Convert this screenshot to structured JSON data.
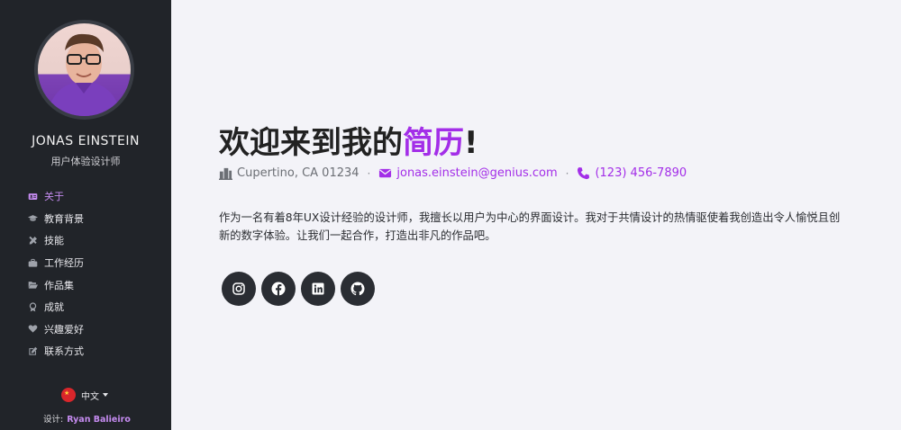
{
  "sidebar": {
    "name": "JONAS EINSTEIN",
    "role": "用户体验设计师",
    "nav": [
      {
        "label": "关于",
        "icon": "id-card-icon",
        "active": true
      },
      {
        "label": "教育背景",
        "icon": "graduation-cap-icon",
        "active": false
      },
      {
        "label": "技能",
        "icon": "tools-icon",
        "active": false
      },
      {
        "label": "工作经历",
        "icon": "briefcase-icon",
        "active": false
      },
      {
        "label": "作品集",
        "icon": "folder-open-icon",
        "active": false
      },
      {
        "label": "成就",
        "icon": "award-icon",
        "active": false
      },
      {
        "label": "兴趣爱好",
        "icon": "heart-icon",
        "active": false
      },
      {
        "label": "联系方式",
        "icon": "edit-icon",
        "active": false
      }
    ],
    "language": "中文",
    "credit_prefix": "设计:",
    "credit_name": "Ryan Balieiro"
  },
  "main": {
    "headline_prefix": "欢迎来到我的",
    "headline_highlight": "简历",
    "headline_suffix": "!",
    "location": "Cupertino, CA 01234",
    "email": "jonas.einstein@genius.com",
    "phone": "(123) 456-7890",
    "separator": "·",
    "bio": "作为一名有着8年UX设计经验的设计师，我擅长以用户为中心的界面设计。我对于共情设计的热情驱使着我创造出令人愉悦且创新的数字体验。让我们一起合作，打造出非凡的作品吧。"
  },
  "colors": {
    "accent": "#a32ee8",
    "sidebar_bg": "#212429",
    "page_bg": "#f3f3f8"
  },
  "social": [
    "instagram-icon",
    "facebook-icon",
    "linkedin-icon",
    "github-icon"
  ]
}
